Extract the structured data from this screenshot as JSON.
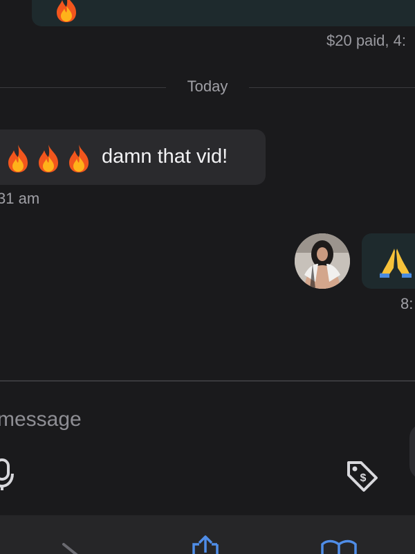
{
  "conversation": {
    "top_message": {
      "emoji": "fire",
      "meta": "$20 paid, 4:"
    },
    "date_divider": "Today",
    "received_message": {
      "emojis": [
        "fire",
        "fire",
        "fire"
      ],
      "text": "damn that vid!",
      "time": "31 am"
    },
    "sent_message": {
      "emoji": "folded-hands",
      "time": "8:"
    }
  },
  "composer": {
    "placeholder": "message"
  },
  "colors": {
    "background": "#1a1a1c",
    "received_bubble": "#2a2a2d",
    "sent_bubble": "#1e2a2d",
    "accent": "#4f8de8"
  },
  "icons": {
    "mic": "microphone-icon",
    "tip": "price-tag-dollar-icon",
    "back": "chevron-icon",
    "share": "share-icon",
    "bookmarks": "book-icon"
  }
}
